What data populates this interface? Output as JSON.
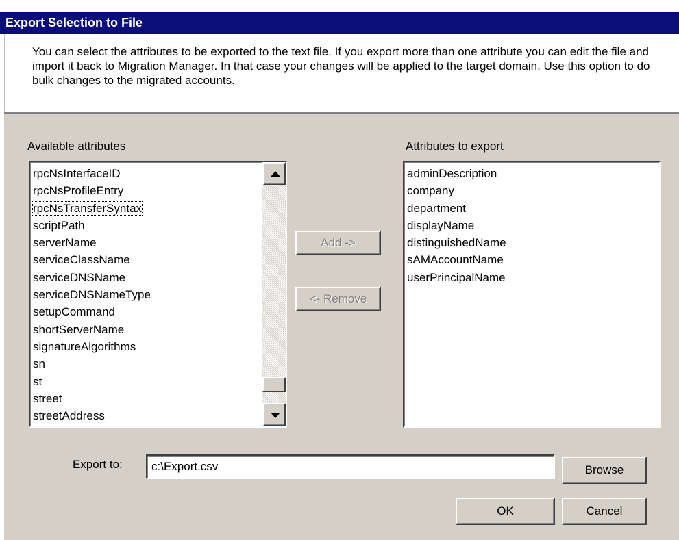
{
  "window": {
    "title": "Export Selection to File"
  },
  "intro": {
    "text": "You can select the attributes to be exported to the text file. If you export more than one attribute you can edit the file and import it back to Migration Manager. In that case your changes will be applied to the target domain. Use this option to do bulk changes to the migrated accounts."
  },
  "available": {
    "label": "Available attributes",
    "items": [
      "rpcNsInterfaceID",
      "rpcNsProfileEntry",
      "rpcNsTransferSyntax",
      "scriptPath",
      "serverName",
      "serviceClassName",
      "serviceDNSName",
      "serviceDNSNameType",
      "setupCommand",
      "shortServerName",
      "signatureAlgorithms",
      "sn",
      "st",
      "street",
      "streetAddress"
    ],
    "focused_index": 2
  },
  "export_list": {
    "label": "Attributes to export",
    "items": [
      "adminDescription",
      "company",
      "department",
      "displayName",
      "distinguishedName",
      "sAMAccountName",
      "userPrincipalName"
    ]
  },
  "buttons": {
    "add": "Add ->",
    "remove": "<- Remove",
    "browse": "Browse",
    "ok": "OK",
    "cancel": "Cancel"
  },
  "export_to": {
    "label": "Export to:",
    "value": "c:\\Export.csv"
  },
  "icons": {
    "scroll_up": "scroll-up-arrow-icon",
    "scroll_down": "scroll-down-arrow-icon"
  },
  "colors": {
    "title_bar": "#0a0d7a",
    "dialog_face": "#d4d0c8"
  }
}
